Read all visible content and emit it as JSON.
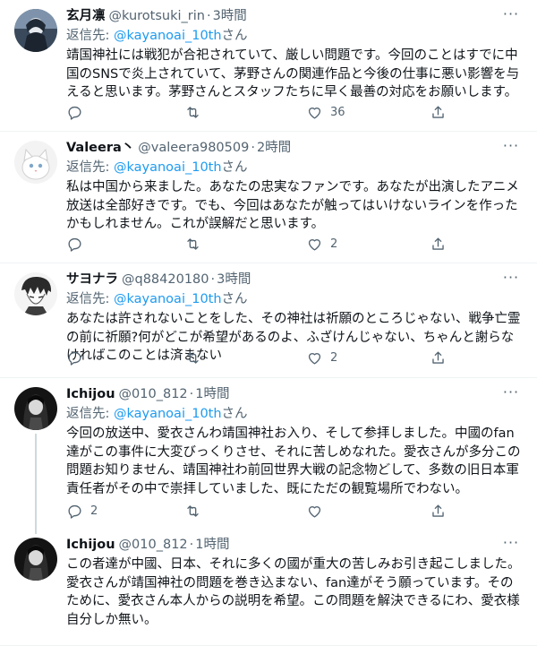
{
  "common": {
    "reply_prefix": "返信先: ",
    "reply_suffix": "さん",
    "dot": "·",
    "more": "···"
  },
  "tweets": [
    {
      "name": "玄月凛",
      "handle": "@kurotsuki_rin",
      "time": "3時間",
      "reply_to": "@kayanoai_10th",
      "text": "靖国神社には戦犯が合祀されていて、厳しい問題です。今回のことはすでに中国のSNSで炎上されていて、茅野さんの関連作品と今後の仕事に悪い影響を与えると思います。茅野さんとスタッフたちに早く最善の対応をお願いします。",
      "replies": "",
      "retweets": "",
      "likes": "36"
    },
    {
      "name": "Valeera丶",
      "handle": "@valeera980509",
      "time": "2時間",
      "reply_to": "@kayanoai_10th",
      "text": "私は中国から来ました。あなたの忠実なファンです。あなたが出演したアニメ放送は全部好きです。でも、今回はあなたが触ってはいけないラインを作ったかもしれません。これが誤解だと思います。",
      "replies": "",
      "retweets": "",
      "likes": "2"
    },
    {
      "name": "サヨナラ",
      "handle": "@q88420180",
      "time": "3時間",
      "reply_to": "@kayanoai_10th",
      "text": "あなたは許されないことをした、その神社は祈願のところじゃない、戦争亡霊の前に祈願?何がどこが希望があるのよ、ふざけんじゃない、ちゃんと謝らなければこのことは済まない",
      "replies": "",
      "retweets": "",
      "likes": "2"
    },
    {
      "name": "Ichijou",
      "handle": "@010_812",
      "time": "1時間",
      "reply_to": "@kayanoai_10th",
      "text": "今回の放送中、愛衣さんわ靖国神社お入り、そして参拝しました。中國のfan達がこの事件に大変びっくりさせ、それに苦しめなれた。愛衣さんが多分この問題お知りません、靖国神社わ前回世界大戦の記念物どして、多数の旧日本軍責任者がその中で崇拝していました、既にただの観覧場所でわない。",
      "replies": "2",
      "retweets": "",
      "likes": ""
    },
    {
      "name": "Ichijou",
      "handle": "@010_812",
      "time": "1時間",
      "reply_to": "",
      "text": "この者達が中國、日本、それに多くの國が重大の苦しみお引き起こしました。愛衣さんが靖国神社の問題を巻き込まない、fan達がそう願っています。そのために、愛衣さん本人からの説明を希望。この問題を解決できるにわ、愛衣様自分しか無い。",
      "replies": "",
      "retweets": "",
      "likes": ""
    }
  ]
}
